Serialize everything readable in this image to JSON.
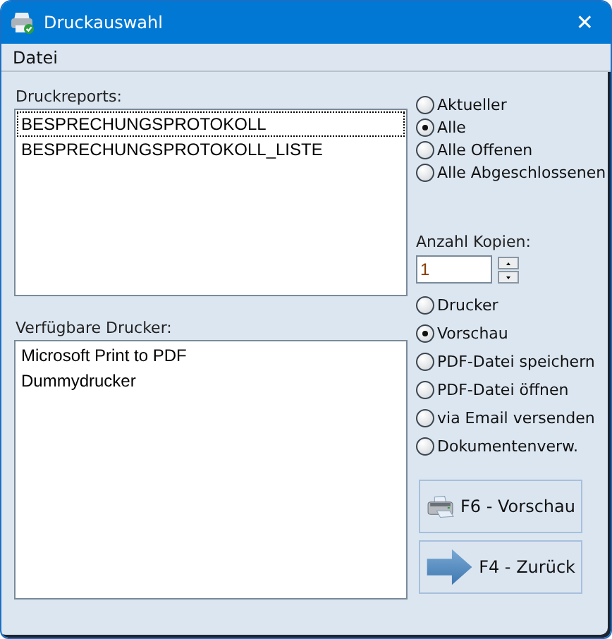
{
  "window": {
    "title": "Druckauswahl",
    "close": "✕"
  },
  "menu": [
    {
      "label": "Datei"
    }
  ],
  "reports": {
    "label": "Druckreports:",
    "items": [
      {
        "text": "BESPRECHUNGSPROTOKOLL",
        "focused": true
      },
      {
        "text": "BESPRECHUNGSPROTOKOLL_LISTE",
        "focused": false
      }
    ]
  },
  "scope_options": [
    {
      "label": "Aktueller",
      "selected": false
    },
    {
      "label": "Alle",
      "selected": true
    },
    {
      "label": "Alle Offenen",
      "selected": false
    },
    {
      "label": "Alle Abgeschlossenen",
      "selected": false
    }
  ],
  "copies": {
    "label": "Anzahl Kopien:",
    "value": "1"
  },
  "printers": {
    "label": "Verfügbare Drucker:",
    "items": [
      {
        "text": "Microsoft Print to PDF"
      },
      {
        "text": "Dummydrucker"
      }
    ]
  },
  "output_options": [
    {
      "label": "Drucker",
      "selected": false
    },
    {
      "label": "Vorschau",
      "selected": true
    },
    {
      "label": "PDF-Datei speichern",
      "selected": false
    },
    {
      "label": "PDF-Datei öffnen",
      "selected": false
    },
    {
      "label": "via Email versenden",
      "selected": false
    },
    {
      "label": "Dokumentenverw.",
      "selected": false
    }
  ],
  "buttons": [
    {
      "kind": "preview",
      "label": "F6 - Vorschau"
    },
    {
      "kind": "back",
      "label": "F4 - Zurück"
    }
  ]
}
